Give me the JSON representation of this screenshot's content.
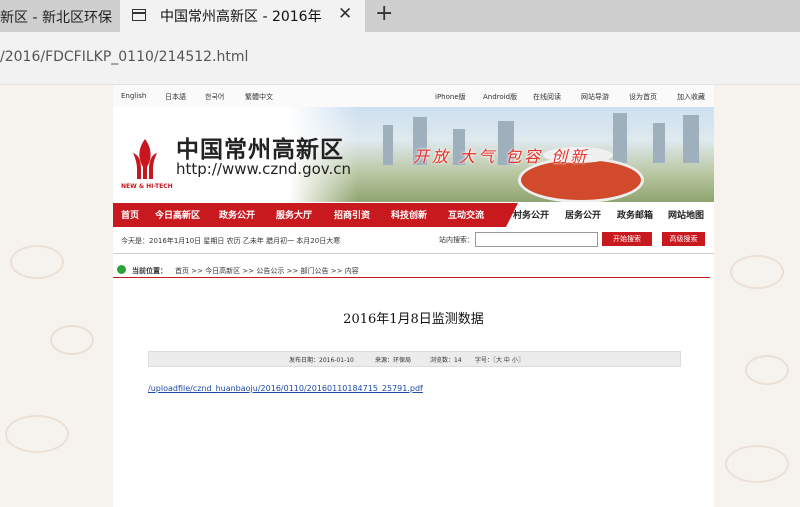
{
  "browser": {
    "tab_inactive": "新区 - 新北区环保",
    "tab_active": "中国常州高新区 - 2016年",
    "new_tab": "+",
    "close": "✕",
    "url": "/2016/FDCFILKP_0110/214512.html"
  },
  "topbar": {
    "links_left": [
      "English",
      "日本語",
      "한국어",
      "繁體中文"
    ],
    "links_right": [
      "iPhone版",
      "Android版",
      "在线阅读",
      "网站导游",
      "设为首页",
      "加入收藏"
    ]
  },
  "header": {
    "title": "中国常州高新区",
    "url": "http://www.cznd.gov.cn",
    "logo_caption": "NEW & HI-TECH",
    "slogan": "开放 大气 包容 创新"
  },
  "nav": {
    "items": [
      "首页",
      "今日高新区",
      "政务公开",
      "服务大厅",
      "招商引资",
      "科技创新",
      "互动交流"
    ],
    "right_items": [
      "村务公开",
      "居务公开",
      "政务邮箱",
      "网站地图"
    ]
  },
  "datebar": {
    "date": "今天是：2016年1月10日 星期日 农历 乙未年 腊月初一 本月20日大寒",
    "search_label": "站内搜索：",
    "search_button": "开始搜索",
    "advanced_button": "高级搜索"
  },
  "breadcrumb": {
    "label": "当前位置：",
    "path": "首页 >> 今日高新区 >> 公告公示 >> 部门公告 >> 内容"
  },
  "article": {
    "title": "2016年1月8日监测数据",
    "publish_date": "发布日期：2016-01-10",
    "source": "来源：环保局",
    "views": "浏览数：14",
    "font_size": "字号：〖大 中 小〗",
    "file_link": "/uploadfile/cznd_huanbaoju/2016/0110/20160110184715_25791.pdf"
  },
  "colors": {
    "brand_red": "#c8191f",
    "link_blue": "#1b4aa8"
  }
}
